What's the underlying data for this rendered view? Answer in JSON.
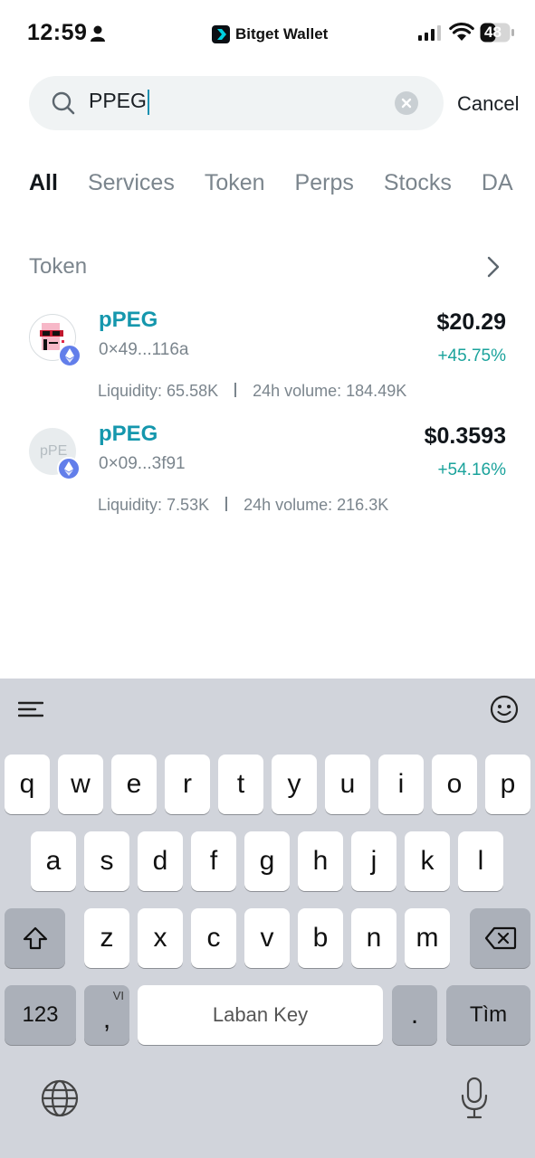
{
  "status_bar": {
    "time": "12:59",
    "brand": "Bitget Wallet",
    "battery": "48"
  },
  "search": {
    "value": "PPEG",
    "cancel_label": "Cancel"
  },
  "tabs": [
    "All",
    "Services",
    "Token",
    "Perps",
    "Stocks",
    "DA"
  ],
  "section": {
    "title": "Token"
  },
  "tokens": [
    {
      "name": "pPEG",
      "address": "0×49...116a",
      "price": "$20.29",
      "change": "+45.75%",
      "liquidity": "Liquidity: 65.58K",
      "volume": "24h volume: 184.49K"
    },
    {
      "name": "pPEG",
      "address": "0×09...3f91",
      "price": "$0.3593",
      "change": "+54.16%",
      "liquidity": "Liquidity: 7.53K",
      "volume": "24h volume: 216.3K",
      "placeholder": "pPE"
    }
  ],
  "keyboard": {
    "row1": [
      "q",
      "w",
      "e",
      "r",
      "t",
      "y",
      "u",
      "i",
      "o",
      "p"
    ],
    "row2": [
      "a",
      "s",
      "d",
      "f",
      "g",
      "h",
      "j",
      "k",
      "l"
    ],
    "row3": [
      "z",
      "x",
      "c",
      "v",
      "b",
      "n",
      "m"
    ],
    "numbers_label": "123",
    "comma_label": ",",
    "lang_label": "VI",
    "space_label": "Laban Key",
    "period_label": ".",
    "return_label": "Tìm"
  },
  "colors": {
    "accent_teal": "#1597ad",
    "positive": "#1ba39c",
    "eth": "#627eea"
  }
}
